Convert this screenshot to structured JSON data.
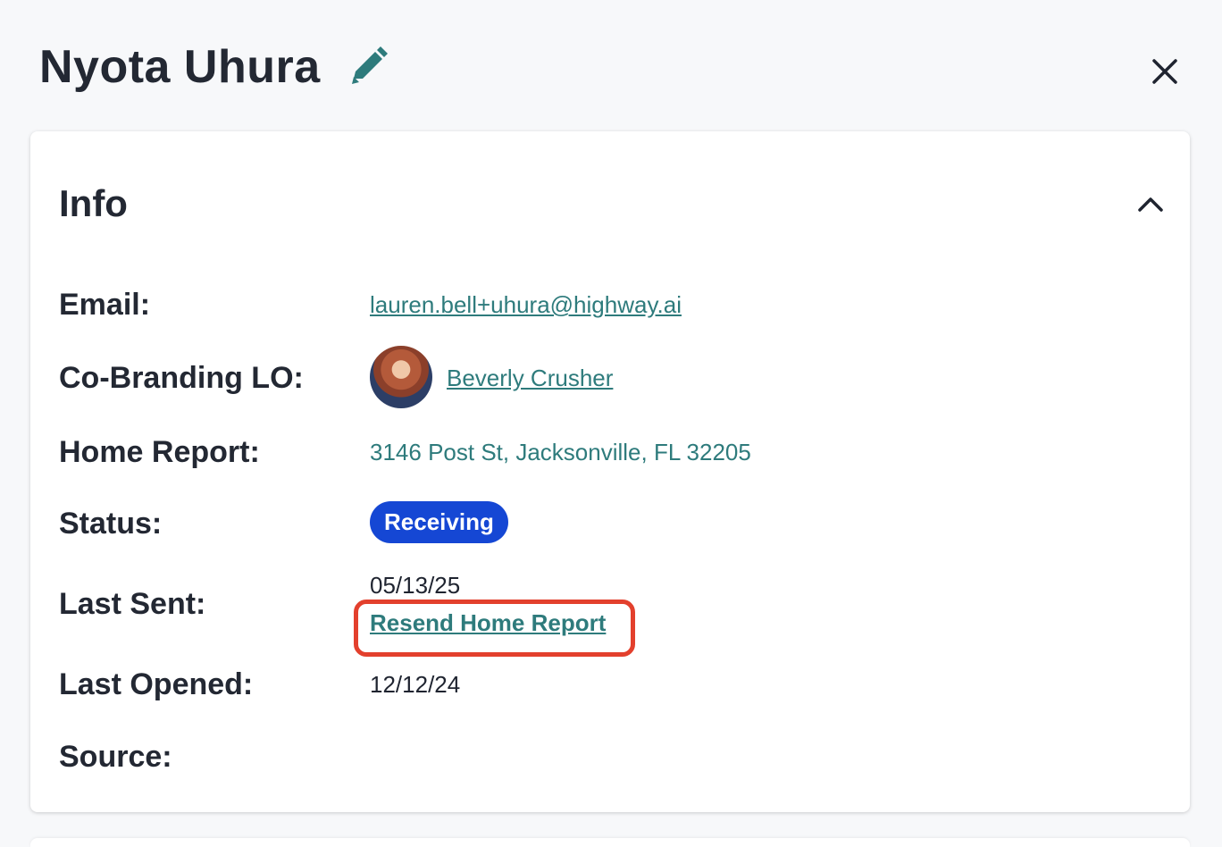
{
  "header": {
    "title": "Nyota Uhura",
    "edit_icon": "pencil-icon",
    "close_icon": "close-icon"
  },
  "info": {
    "title": "Info",
    "collapse_icon": "chevron-up-icon",
    "email_label": "Email:",
    "email_value": "lauren.bell+uhura@highway.ai",
    "cobranding_label": "Co-Branding LO:",
    "cobranding_name": "Beverly Crusher",
    "home_report_label": "Home Report:",
    "home_report_value": "3146 Post St, Jacksonville, FL 32205",
    "status_label": "Status:",
    "status_value": "Receiving",
    "last_sent_label": "Last Sent:",
    "last_sent_value": "05/13/25",
    "resend_label": "Resend Home Report",
    "last_opened_label": "Last Opened:",
    "last_opened_value": "12/12/24",
    "source_label": "Source:",
    "source_value": ""
  },
  "colors": {
    "accent_teal": "#2e7b7c",
    "status_badge": "#1547d4",
    "highlight": "#e3402d"
  }
}
